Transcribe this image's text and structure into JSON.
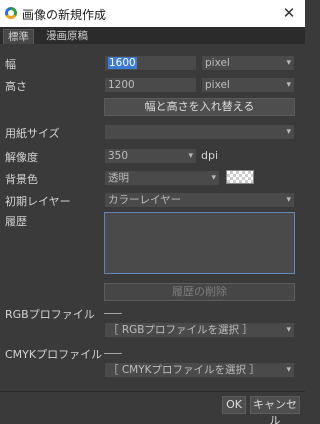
{
  "window": {
    "title": "画像の新規作成",
    "close_glyph": "✕"
  },
  "tabs": [
    {
      "label": "標準",
      "active": true
    },
    {
      "label": "漫画原稿",
      "active": false
    }
  ],
  "fields": {
    "width": {
      "label": "幅",
      "value": "1600",
      "unit": "pixel"
    },
    "height": {
      "label": "高さ",
      "value": "1200",
      "unit": "pixel"
    },
    "swap_button": "幅と高さを入れ替える",
    "paper_size": {
      "label": "用紙サイズ",
      "value": ""
    },
    "resolution": {
      "label": "解像度",
      "value": "350",
      "unit": "dpi"
    },
    "background": {
      "label": "背景色",
      "value": "透明"
    },
    "initial_layer": {
      "label": "初期レイヤー",
      "value": "カラーレイヤー"
    },
    "history": {
      "label": "履歴",
      "clear_button": "履歴の削除"
    },
    "rgb_profile": {
      "label": "RGBプロファイル",
      "select": "［ RGBプロファイルを選択 ］"
    },
    "cmyk_profile": {
      "label": "CMYKプロファイル",
      "select": "［ CMYKプロファイルを選択 ］"
    }
  },
  "footer": {
    "ok": "OK",
    "cancel": "キャンセル"
  },
  "colors": {
    "selection": "#3d7bd9",
    "background": "#3a3a3a",
    "field": "#4a4a4a",
    "history_border": "#5d88b8"
  },
  "icons": {
    "app": "app-logo-icon",
    "close": "close-icon",
    "dropdown": "chevron-down-icon"
  }
}
